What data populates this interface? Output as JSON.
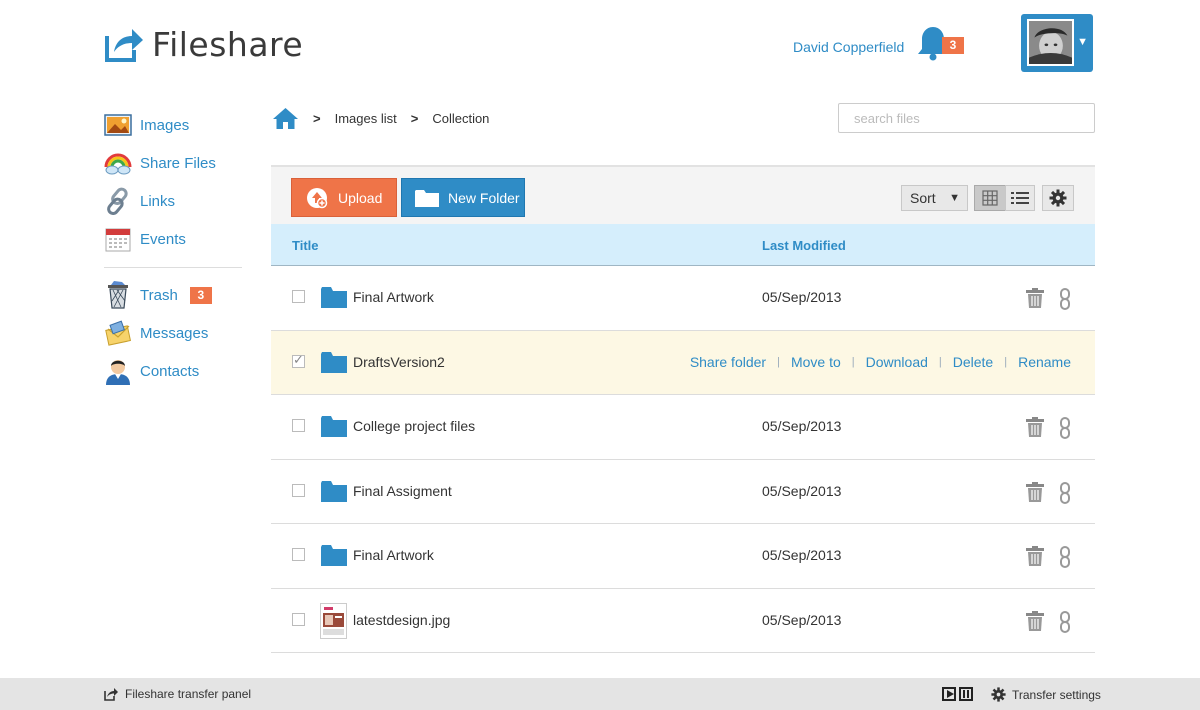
{
  "app": {
    "name": "Fileshare"
  },
  "user": {
    "name": "David Copperfield",
    "notifications": "3"
  },
  "sidebar": {
    "items": [
      {
        "label": "Images",
        "icon": "images-icon"
      },
      {
        "label": "Share Files",
        "icon": "share-files-icon"
      },
      {
        "label": "Links",
        "icon": "links-icon"
      },
      {
        "label": "Events",
        "icon": "events-icon"
      }
    ],
    "secondary": [
      {
        "label": "Trash",
        "icon": "trash-icon",
        "badge": "3"
      },
      {
        "label": "Messages",
        "icon": "messages-icon"
      },
      {
        "label": "Contacts",
        "icon": "contacts-icon"
      }
    ]
  },
  "breadcrumb": {
    "items": [
      "Images list",
      "Collection"
    ]
  },
  "search": {
    "placeholder": "search files",
    "value": ""
  },
  "toolbar": {
    "upload_label": "Upload",
    "new_folder_label": "New Folder",
    "sort_label": "Sort",
    "active_view": "grid"
  },
  "table": {
    "columns": {
      "title": "Title",
      "modified": "Last Modified"
    },
    "rows": [
      {
        "name": "Final Artwork",
        "type": "folder",
        "date": "05/Sep/2013",
        "checked": false
      },
      {
        "name": "DraftsVersion2",
        "type": "folder",
        "date": "",
        "checked": true,
        "actions": [
          "Share folder",
          "Move to",
          "Download",
          "Delete",
          "Rename"
        ]
      },
      {
        "name": "College project files",
        "type": "folder",
        "date": "05/Sep/2013",
        "checked": false
      },
      {
        "name": "Final Assigment",
        "type": "folder",
        "date": "05/Sep/2013",
        "checked": false
      },
      {
        "name": "Final Artwork",
        "type": "folder",
        "date": "05/Sep/2013",
        "checked": false
      },
      {
        "name": "latestdesign.jpg",
        "type": "image",
        "date": "05/Sep/2013",
        "checked": false
      }
    ]
  },
  "footer": {
    "left_label": "Fileshare transfer panel",
    "settings_label": "Transfer settings"
  },
  "colors": {
    "accent": "#2f8cc6",
    "badge": "#ef7448",
    "header_row": "#d5eefc",
    "selected_row": "#fdf8e4"
  }
}
